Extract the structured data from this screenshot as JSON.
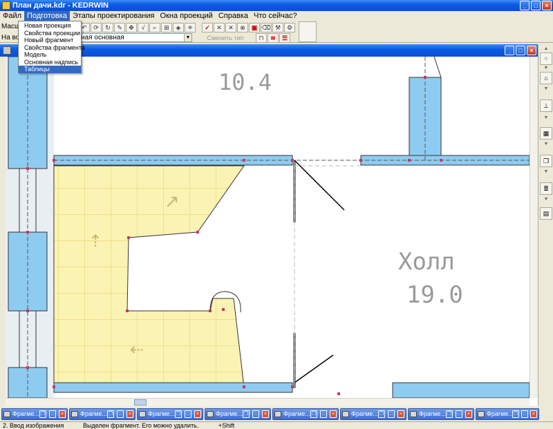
{
  "window": {
    "title": "План дачи.kdr - KEDRWIN"
  },
  "menubar": {
    "items": [
      "Файл",
      "Подготовка",
      "Этапы проектирования",
      "Окна проекций",
      "Справка",
      "Что сейчас?"
    ]
  },
  "dropdown": {
    "items": [
      "Новая проекция",
      "Свойства проекции",
      "Новый фрагмент",
      "Свойства фрагмента",
      "Модель",
      "Основная надпись",
      "Таблицы"
    ],
    "selected": "Таблицы"
  },
  "toolbar": {
    "scale_label": "Масшт",
    "view_label": "На во",
    "layer_combo_value": "ная основная",
    "change_line_type_label": "Сменить тип линии"
  },
  "plan": {
    "room_top_label": "10.4",
    "room_hall_name": "Холл",
    "room_hall_area": "19.0"
  },
  "fragments": {
    "label": "Фрагме...",
    "count": 8
  },
  "status": {
    "mode": "2. Ввод изображения",
    "message": "Выделен фрагмент. Его можно удалить.",
    "hint": "+Shift"
  },
  "colors": {
    "wall_fill": "#8ecbf0",
    "stair_fill": "#faf3b4",
    "titlebar": "#0b5ce4",
    "selection": "#316ac5"
  }
}
